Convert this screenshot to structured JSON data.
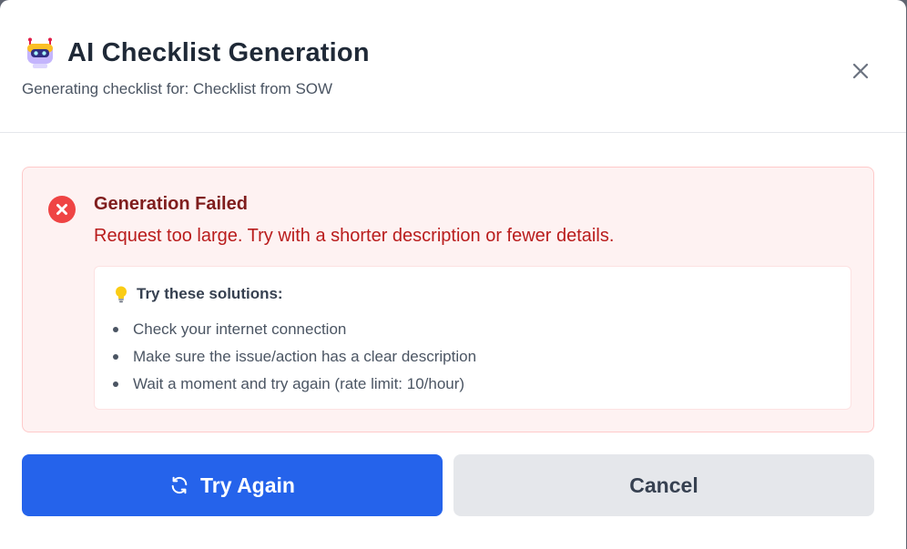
{
  "dialog": {
    "title": "AI Checklist Generation",
    "subtitle": "Generating checklist for: Checklist from SOW",
    "title_icon": "robot-icon",
    "close_icon": "close-icon"
  },
  "error": {
    "title": "Generation Failed",
    "message": "Request too large. Try with a shorter description or fewer details.",
    "icon": "error-x-icon",
    "solutions": {
      "icon": "lightbulb-icon",
      "title": "Try these solutions:",
      "items": [
        "Check your internet connection",
        "Make sure the issue/action has a clear description",
        "Wait a moment and try again (rate limit: 10/hour)"
      ]
    }
  },
  "actions": {
    "retry_label": "Try Again",
    "retry_icon": "refresh-icon",
    "cancel_label": "Cancel"
  },
  "colors": {
    "primary": "#2563eb",
    "error_bg": "#fef2f2",
    "error_border": "#fecaca",
    "error_title": "#7f1d1d",
    "error_text": "#b91c1c",
    "error_icon": "#ef4444",
    "secondary_bg": "#e5e7eb"
  }
}
